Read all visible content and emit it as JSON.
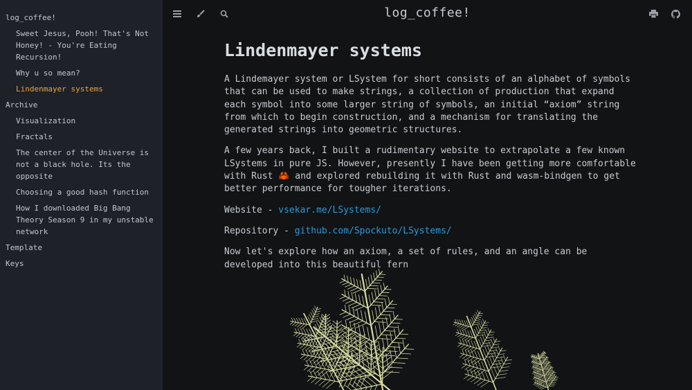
{
  "sidebar": {
    "items": [
      {
        "label": "log_coffee!",
        "level": 0,
        "active": false
      },
      {
        "label": "Sweet Jesus, Pooh! That's Not Honey! - You're Eating Recursion!",
        "level": 1,
        "active": false
      },
      {
        "label": "Why u so mean?",
        "level": 1,
        "active": false
      },
      {
        "label": "Lindenmayer systems",
        "level": 1,
        "active": true
      },
      {
        "label": "Archive",
        "level": 0,
        "active": false
      },
      {
        "label": "Visualization",
        "level": 1,
        "active": false
      },
      {
        "label": "Fractals",
        "level": 1,
        "active": false
      },
      {
        "label": "The center of the Universe is not a black hole. Its the opposite",
        "level": 1,
        "active": false
      },
      {
        "label": "Choosing a good hash function",
        "level": 1,
        "active": false
      },
      {
        "label": "How I downloaded Big Bang Theory Season 9 in my unstable network",
        "level": 1,
        "active": false
      },
      {
        "label": "Template",
        "level": 0,
        "active": false
      },
      {
        "label": "Keys",
        "level": 0,
        "active": false
      }
    ]
  },
  "header": {
    "title": "log_coffee!",
    "icons": [
      "menu-icon",
      "brush-icon",
      "search-icon",
      "print-icon",
      "github-icon"
    ]
  },
  "article": {
    "title": "Lindenmayer systems",
    "p1": "A Lindemayer system or LSystem for short consists of an alphabet of symbols that can be used to make strings, a collection of production that expand each symbol into some larger string of symbols, an initial “axiom” string from which to begin construction, and a mechanism for translating the generated strings into geometric structures.",
    "p2_a": "A few years back, I built a rudimentary website to extrapolate a few known LSystems in pure JS. However, presently I have been getting more comfortable with Rust ",
    "p2_emoji": "🦀",
    "p2_b": " and explored rebuilding it with Rust and wasm-bindgen to get better performance for tougher iterations.",
    "website_label": "Website - ",
    "website_link": "vsekar.me/LSystems/",
    "repo_label": "Repository - ",
    "repo_link": "github.com/Spockuto/LSystems/",
    "p3": "Now let's explore how an axiom, a set of rules, and an angle can be developed into this beautiful fern"
  },
  "colors": {
    "sidebar_bg": "#1e2127",
    "main_bg": "#111315",
    "accent": "#e8a44a",
    "link": "#2b9ad6",
    "fern": "#d8dca0"
  }
}
